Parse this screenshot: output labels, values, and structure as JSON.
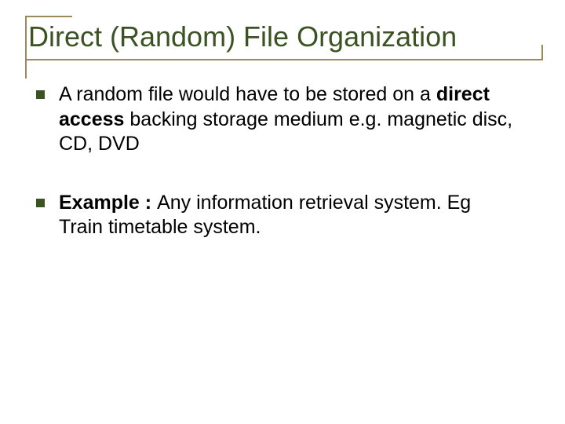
{
  "title": "Direct (Random) File Organization",
  "bullets": [
    {
      "segments": [
        {
          "text": "A random file would have to be stored on a ",
          "bold": false
        },
        {
          "text": "direct access",
          "bold": true
        },
        {
          "text": " backing storage medium e.g. magnetic disc, CD, DVD",
          "bold": false
        }
      ]
    },
    {
      "segments": [
        {
          "text": "Example : ",
          "bold": true
        },
        {
          "text": "Any information retrieval system. Eg Train timetable system.",
          "bold": false
        }
      ]
    }
  ]
}
